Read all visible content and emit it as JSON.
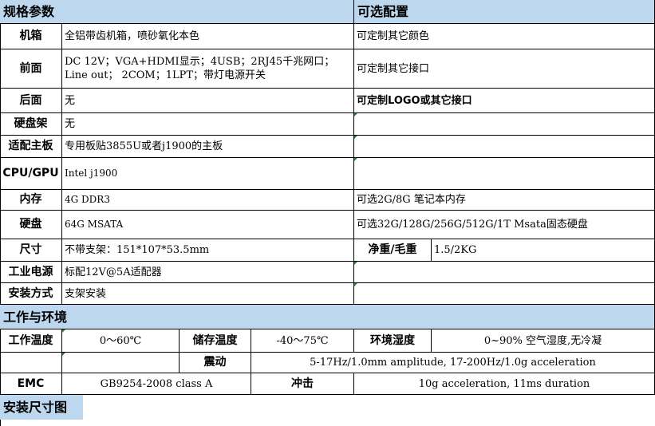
{
  "headers": {
    "spec": "规格参数",
    "optional": "可选配置",
    "env": "工作与环境",
    "install_size": "安装尺寸图"
  },
  "rows": {
    "chassis": {
      "label": "机箱",
      "value": "全铝带齿机箱，喷砂氧化本色",
      "option": "可定制其它颜色"
    },
    "front": {
      "label": "前面",
      "value": "DC 12V；VGA+HDMI显示；4USB；2RJ45千兆网口；Line out； 2COM；1LPT；带灯电源开关",
      "option": "可定制其它接口"
    },
    "rear": {
      "label": "后面",
      "value": "无",
      "option": "可定制LOGO或其它接口"
    },
    "hdd_rack": {
      "label": "硬盘架",
      "value": "无",
      "option": ""
    },
    "board": {
      "label": "适配主板",
      "value": "专用板贴3855U或者j1900的主板",
      "option": ""
    },
    "cpu": {
      "label": "CPU/GPU",
      "value": "Intel j1900",
      "option": ""
    },
    "memory": {
      "label": "内存",
      "value": "4G DDR3",
      "option": "可选2G/8G 笔记本内存"
    },
    "disk": {
      "label": "硬盘",
      "value": "64G MSATA",
      "option": "可选32G/128G/256G/512G/1T Msata固态硬盘"
    },
    "size": {
      "label": "尺寸",
      "value": "不带支架：151*107*53.5mm",
      "weight_label": "净重/毛重",
      "weight_value": "1.5/2KG"
    },
    "power": {
      "label": "工业电源",
      "value": "标配12V@5A适配器",
      "option": ""
    },
    "mount": {
      "label": "安装方式",
      "value": "支架安装",
      "option": ""
    }
  },
  "env": {
    "work_temp_label": "工作温度",
    "work_temp_value": "0～60℃",
    "store_temp_label": "储存温度",
    "store_temp_value": "-40～75℃",
    "humidity_label": "环境湿度",
    "humidity_value": "0~90% 空气湿度,无冷凝",
    "vibration_label": "震动",
    "vibration_value": "5-17Hz/1.0mm amplitude, 17-200Hz/1.0g acceleration",
    "emc_label": "EMC",
    "emc_value": "GB9254-2008 class A",
    "shock_label": "冲击",
    "shock_value": "10g acceleration, 11ms duration"
  }
}
